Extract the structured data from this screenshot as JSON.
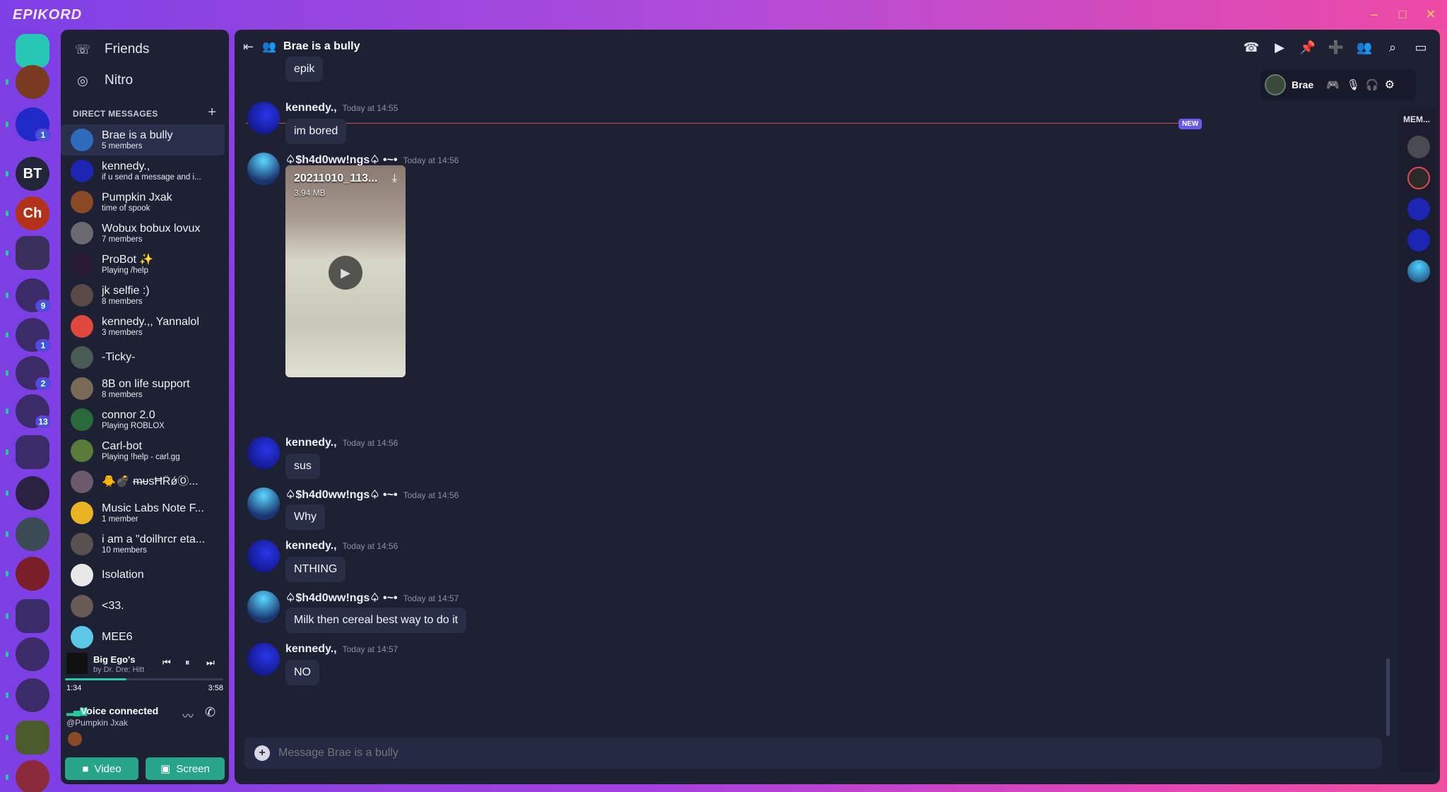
{
  "app": {
    "brand": "EPIKORD",
    "win_min": "–",
    "win_max": "□",
    "win_close": "✕"
  },
  "rail": {
    "servers": [
      {
        "label": "",
        "bg": "#27c7b5",
        "badge": ""
      },
      {
        "label": "",
        "bg": "#7a3a20",
        "badge": ""
      },
      {
        "label": "",
        "bg": "#1f2ac8",
        "badge": "1"
      },
      {
        "label": "BT",
        "bg": "#23253a",
        "badge": ""
      },
      {
        "label": "Ch",
        "bg": "#b5321a",
        "badge": ""
      },
      {
        "label": "",
        "bg": "#3a2f5a",
        "badge": ""
      },
      {
        "label": "",
        "bg": "#3b2b69",
        "badge": "9"
      },
      {
        "label": "",
        "bg": "#3b2b69",
        "badge": "1"
      },
      {
        "label": "",
        "bg": "#3b2b69",
        "badge": "2"
      },
      {
        "label": "",
        "bg": "#3b2b69",
        "badge": "13"
      },
      {
        "label": "",
        "bg": "#3b2b69",
        "badge": ""
      },
      {
        "label": "",
        "bg": "#2a2240",
        "badge": ""
      },
      {
        "label": "",
        "bg": "#3b4a55",
        "badge": ""
      },
      {
        "label": "",
        "bg": "#7a1f2a",
        "badge": ""
      },
      {
        "label": "",
        "bg": "#3b2b69",
        "badge": ""
      },
      {
        "label": "",
        "bg": "#3b2b69",
        "badge": ""
      },
      {
        "label": "",
        "bg": "#3b2b69",
        "badge": ""
      },
      {
        "label": "",
        "bg": "#4a5a2a",
        "badge": ""
      },
      {
        "label": "",
        "bg": "#8a2a3a",
        "badge": ""
      }
    ]
  },
  "dm": {
    "friends": "Friends",
    "nitro": "Nitro",
    "header": "DIRECT MESSAGES",
    "add": "+",
    "items": [
      {
        "name": "Brae is a bully",
        "sub": "5 members",
        "color": "#2f6bbd"
      },
      {
        "name": "kennedy.,",
        "sub": "if u send a message and i...",
        "color": "#1d25b5"
      },
      {
        "name": "Pumpkin Jxak",
        "sub": "time of spook",
        "color": "#8a4a25"
      },
      {
        "name": "Wobux bobux lovux",
        "sub": "7 members",
        "color": "#6a6a70"
      },
      {
        "name": "ProBot ✨",
        "sub": "Playing /help",
        "color": "#2a1a35"
      },
      {
        "name": "jk selfie :)",
        "sub": "8 members",
        "color": "#5a4a45"
      },
      {
        "name": "kennedy.,, Yannalol",
        "sub": "3 members",
        "color": "#e0473f"
      },
      {
        "name": "-Ticky-",
        "sub": "",
        "color": "#4a5a55"
      },
      {
        "name": "8B on life support",
        "sub": "8 members",
        "color": "#7a6a55"
      },
      {
        "name": "connor 2.0",
        "sub": "Playing ROBLOX",
        "color": "#2a6a3a"
      },
      {
        "name": "Carl-bot",
        "sub": "Playing !help - carl.gg",
        "color": "#5a7a3a"
      },
      {
        "name": "🐥💣 ᵯᵾsĦȒǿⓄ...",
        "sub": "",
        "color": "#6a5a6a"
      },
      {
        "name": "Music Labs Note F...",
        "sub": "1 member",
        "color": "#e8b424"
      },
      {
        "name": "i am a \"doilhrcr eta...",
        "sub": "10 members",
        "color": "#5a5050"
      },
      {
        "name": "Isolation",
        "sub": "",
        "color": "#e8e8e8"
      },
      {
        "name": "<33.",
        "sub": "",
        "color": "#6a5a55"
      },
      {
        "name": "MEE6",
        "sub": "",
        "color": "#5cc8e8"
      }
    ],
    "player": {
      "title": "Big Ego's",
      "artist": "by Dr. Dre; Hitt",
      "elapsed": "1:34",
      "total": "3:58",
      "progress": 0.39
    },
    "voice": {
      "status": "Voice connected",
      "channel": "@Pumpkin Jxak",
      "video": "Video",
      "screen": "Screen"
    }
  },
  "channel": {
    "name": "Brae is a bully",
    "composer_placeholder": "Message Brae is a bully",
    "new_tag": "NEW"
  },
  "voice_panel": {
    "user": "Brae"
  },
  "members_label": "MEM...",
  "messages": [
    {
      "author": "",
      "time": "",
      "text": "epik",
      "kind": "cont"
    },
    {
      "author": "kennedy.,",
      "time": "Today at 14:55",
      "text": "im bored",
      "kind": "k"
    },
    {
      "author": "♤$h4d0ww!ngs♤ •~•",
      "time": "Today at 14:56",
      "text": "",
      "kind": "s",
      "attachment": {
        "name": "20211010_113...",
        "size": "3.94 MB"
      }
    },
    {
      "author": "kennedy.,",
      "time": "Today at 14:56",
      "text": "sus",
      "kind": "k"
    },
    {
      "author": "♤$h4d0ww!ngs♤ •~•",
      "time": "Today at 14:56",
      "text": "Why",
      "kind": "s"
    },
    {
      "author": "kennedy.,",
      "time": "Today at 14:56",
      "text": "NTHING",
      "kind": "k"
    },
    {
      "author": "♤$h4d0ww!ngs♤ •~•",
      "time": "Today at 14:57",
      "text": "Milk then cereal best way to do it",
      "kind": "s"
    },
    {
      "author": "kennedy.,",
      "time": "Today at 14:57",
      "text": "NO",
      "kind": "k"
    }
  ]
}
